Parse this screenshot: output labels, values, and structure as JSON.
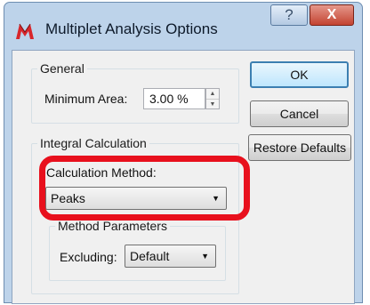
{
  "window": {
    "title": "Multiplet Analysis Options",
    "help_label": "?",
    "close_label": "X",
    "icons": {
      "app": "mnova-app-icon",
      "help": "help-icon",
      "close": "close-icon"
    }
  },
  "general": {
    "legend": "General",
    "minimum_area_label": "Minimum Area:",
    "minimum_area_value": "3.00 %"
  },
  "integral": {
    "legend": "Integral Calculation",
    "calculation_method_label": "Calculation Method:",
    "calculation_method_value": "Peaks",
    "method_parameters": {
      "legend": "Method Parameters",
      "excluding_label": "Excluding:",
      "excluding_value": "Default"
    }
  },
  "buttons": {
    "ok": "OK",
    "cancel": "Cancel",
    "restore_defaults": "Restore Defaults"
  },
  "colors": {
    "highlight": "#e8101d",
    "titlebar": "#bdd3ea",
    "close_button": "#c34331"
  }
}
